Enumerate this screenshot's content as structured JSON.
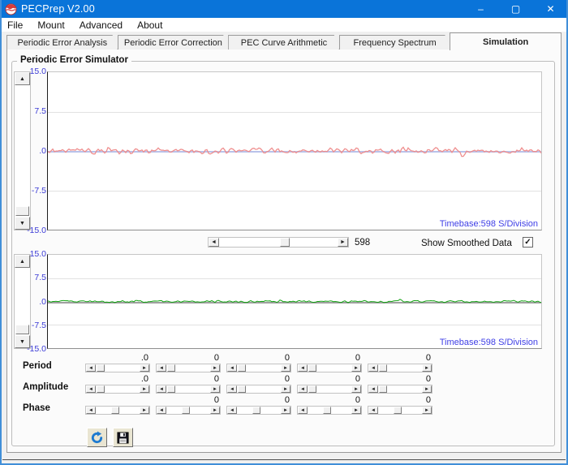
{
  "window": {
    "title": "PECPrep V2.00",
    "controls": {
      "minimize": "–",
      "maximize": "▢",
      "close": "✕"
    }
  },
  "menu": {
    "items": [
      "File",
      "Mount",
      "Advanced",
      "About"
    ]
  },
  "tabs": {
    "items": [
      {
        "label": "Periodic Error Analysis",
        "active": false
      },
      {
        "label": "Periodic Error Correction",
        "active": false
      },
      {
        "label": "PEC Curve Arithmetic",
        "active": false
      },
      {
        "label": "Frequency Spectrum",
        "active": false
      },
      {
        "label": "Simulation",
        "active": true
      }
    ]
  },
  "groupbox": {
    "title": "Periodic Error Simulator"
  },
  "chart_data": [
    {
      "id": "simulator-raw",
      "type": "line",
      "title": "",
      "ylim": [
        -15,
        15
      ],
      "ytick_labels": [
        "15.0",
        "7.5",
        ".0",
        "-7.5",
        "-15.0"
      ],
      "grid": "horizontal",
      "timebase_label": "Timebase:598 S/Division",
      "zero_line_color": "#b9c2ea",
      "series": [
        {
          "name": "simulated-periodic-error",
          "color": "#ef8e8e",
          "baseline": 0,
          "noise_amplitude": 0.65,
          "seed": 42
        }
      ]
    },
    {
      "id": "simulator-smoothed",
      "type": "line",
      "title": "",
      "ylim": [
        -15,
        15
      ],
      "ytick_labels": [
        "15.0",
        "7.5",
        ".0",
        "-7.5",
        "-15.0"
      ],
      "grid": "horizontal",
      "timebase_label": "Timebase:598 S/Division",
      "zero_line_color": "#9f9f9f",
      "series": [
        {
          "name": "smoothed-periodic-error",
          "color": "#12a312",
          "baseline": 0,
          "noise_amplitude": 0.4,
          "seed": 7
        }
      ]
    }
  ],
  "scroll_row": {
    "value": "598",
    "thumb_fraction": 0.55,
    "show_smoothed_label": "Show Smoothed Data",
    "show_smoothed_checked": true,
    "checkmark": "✓"
  },
  "sliders": {
    "rows": [
      {
        "label": "Period",
        "values": [
          ".0",
          "0",
          "0",
          "0",
          "0"
        ],
        "thumb_fraction": 0.02
      },
      {
        "label": "Amplitude",
        "values": [
          ".0",
          "0",
          "0",
          "0",
          "0"
        ],
        "thumb_fraction": 0.02
      },
      {
        "label": "Phase",
        "values": [
          "",
          "0",
          "0",
          "0",
          "0"
        ],
        "thumb_fraction": 0.42
      }
    ]
  },
  "action_buttons": {
    "refresh": "refresh-icon",
    "save": "save-icon"
  },
  "colors": {
    "titlebar": "#0a74d9",
    "axis_text": "#3b3bd6",
    "window_border": "#418fd8"
  }
}
